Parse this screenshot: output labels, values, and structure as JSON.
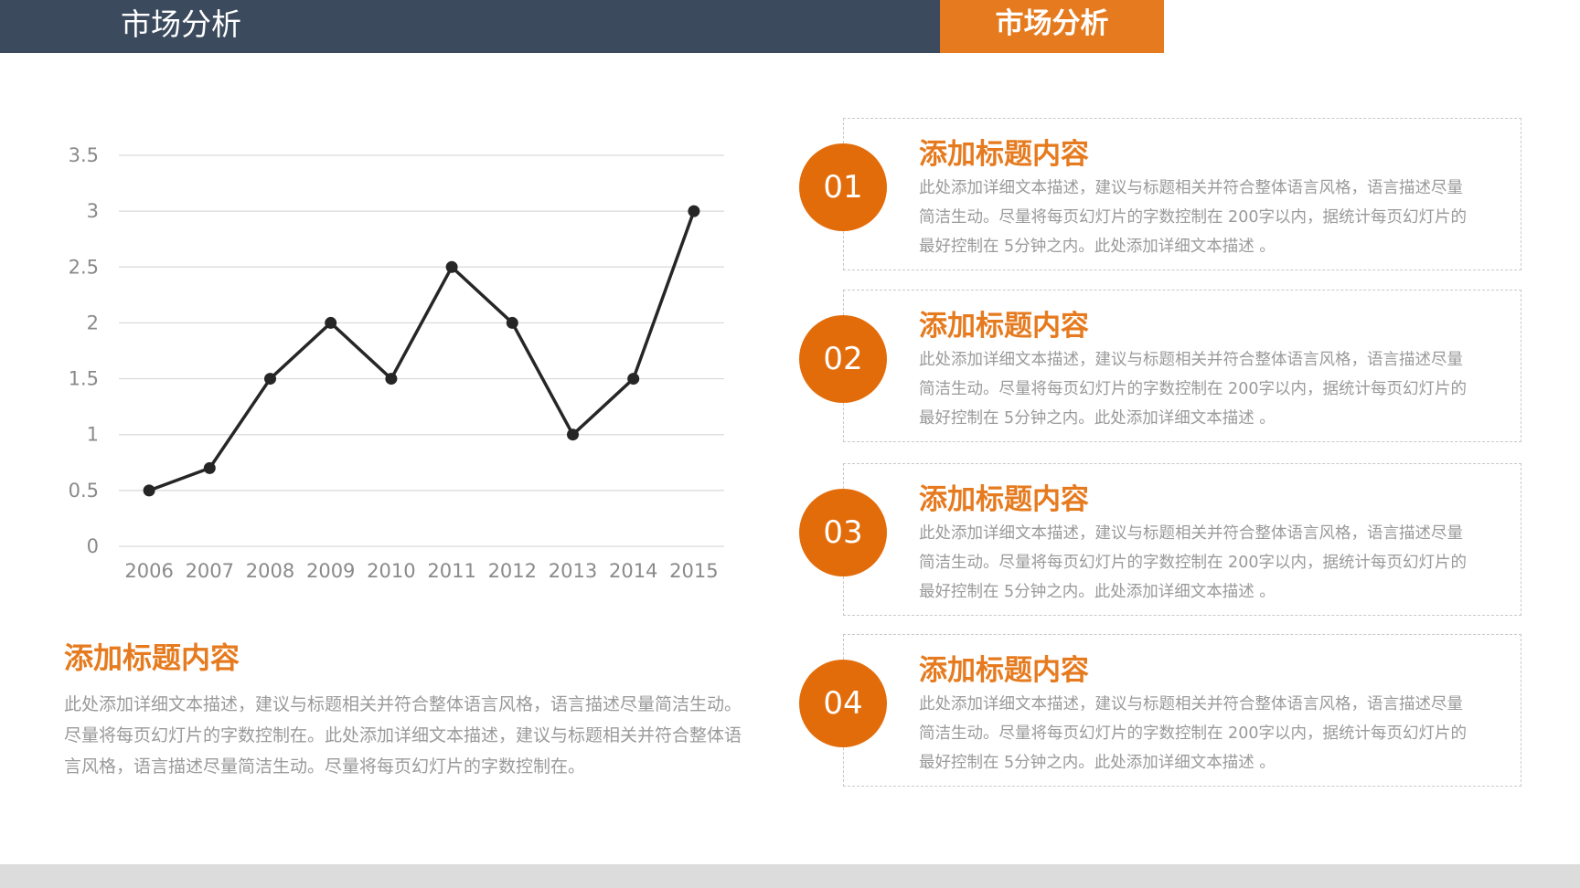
{
  "header": {
    "title": "市场分析",
    "tag": "市场分析"
  },
  "colors": {
    "header_bg": "#3c4a5e",
    "accent": "#e67a1e",
    "circle": "#e36c0a",
    "line": "#262626",
    "footer": "#dcdcdc"
  },
  "chart_data": {
    "type": "line",
    "x": [
      "2006",
      "2007",
      "2008",
      "2009",
      "2010",
      "2011",
      "2012",
      "2013",
      "2014",
      "2015"
    ],
    "series": [
      {
        "values": [
          0.5,
          0.7,
          1.5,
          2.0,
          1.5,
          2.5,
          2.0,
          1.0,
          1.5,
          3.0
        ]
      }
    ],
    "yticks": [
      "0",
      "0.5",
      "1",
      "1.5",
      "2",
      "2.5",
      "3",
      "3.5"
    ],
    "ylim": [
      0,
      3.5
    ],
    "grid": true,
    "legend": "none"
  },
  "left_block": {
    "title": "添加标题内容",
    "lines": [
      "此处添加详细文本描述，建议与标题相关并符合整体语言风格，语言描述尽量简洁生动。",
      "尽量将每页幻灯片的字数控制在。此处添加详细文本描述，建议与标题相关并符合整体语",
      "言风格，语言描述尽量简洁生动。尽量将每页幻灯片的字数控制在。"
    ]
  },
  "items": [
    {
      "number": "01",
      "title": "添加标题内容",
      "lines": [
        "此处添加详细文本描述，建议与标题相关并符合整体语言风格，语言描述尽量",
        "简洁生动。尽量将每页幻灯片的字数控制在 200字以内，据统计每页幻灯片的",
        "最好控制在  5分钟之内。此处添加详细文本描述 。"
      ]
    },
    {
      "number": "02",
      "title": "添加标题内容",
      "lines": [
        "此处添加详细文本描述，建议与标题相关并符合整体语言风格，语言描述尽量",
        "简洁生动。尽量将每页幻灯片的字数控制在 200字以内，据统计每页幻灯片的",
        "最好控制在  5分钟之内。此处添加详细文本描述 。"
      ]
    },
    {
      "number": "03",
      "title": "添加标题内容",
      "lines": [
        "此处添加详细文本描述，建议与标题相关并符合整体语言风格，语言描述尽量",
        "简洁生动。尽量将每页幻灯片的字数控制在 200字以内，据统计每页幻灯片的",
        "最好控制在  5分钟之内。此处添加详细文本描述 。"
      ]
    },
    {
      "number": "04",
      "title": "添加标题内容",
      "lines": [
        "此处添加详细文本描述，建议与标题相关并符合整体语言风格，语言描述尽量",
        "简洁生动。尽量将每页幻灯片的字数控制在 200字以内，据统计每页幻灯片的",
        "最好控制在  5分钟之内。此处添加详细文本描述 。"
      ]
    }
  ]
}
